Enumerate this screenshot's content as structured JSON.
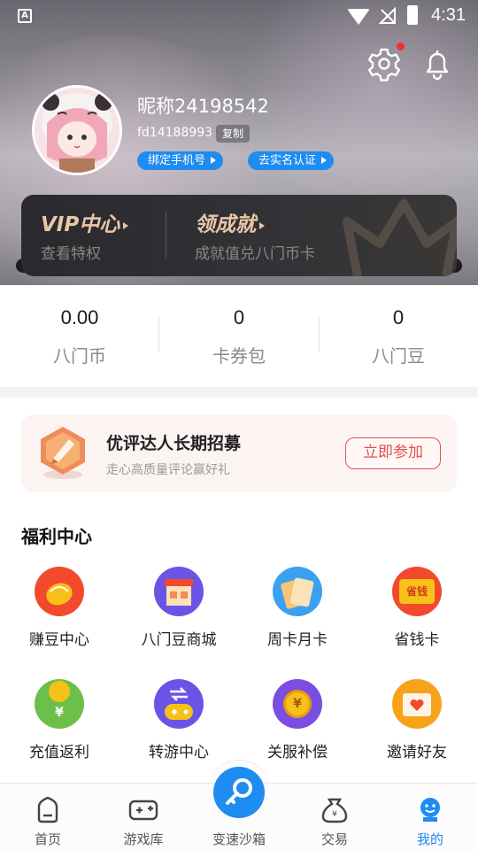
{
  "status_bar": {
    "time": "4:31",
    "notification_icon_letter": "A"
  },
  "profile": {
    "nickname": "昵称24198542",
    "user_id": "fd14188993",
    "copy_label": "复制",
    "bind_phone_label": "绑定手机号",
    "real_name_label": "去实名认证"
  },
  "vip_card": {
    "vip_title": "VIP中心",
    "vip_sub": "查看特权",
    "achievement_title": "领成就",
    "achievement_sub": "成就值兑八门币卡"
  },
  "stats": [
    {
      "value": "0.00",
      "label": "八门币"
    },
    {
      "value": "0",
      "label": "卡券包"
    },
    {
      "value": "0",
      "label": "八门豆"
    }
  ],
  "recruit_banner": {
    "title": "优评达人长期招募",
    "subtitle": "走心高质量评论赢好礼",
    "button_label": "立即参加"
  },
  "welfare": {
    "title": "福利中心",
    "items": [
      {
        "label": "赚豆中心",
        "icon": "bean-icon"
      },
      {
        "label": "八门豆商城",
        "icon": "shop-icon"
      },
      {
        "label": "周卡月卡",
        "icon": "card-icon"
      },
      {
        "label": "省钱卡",
        "icon": "save-money-card-icon",
        "icon_text": "省钱"
      },
      {
        "label": "充值返利",
        "icon": "recharge-rebate-icon",
        "icon_text": "¥"
      },
      {
        "label": "转游中心",
        "icon": "transfer-game-icon"
      },
      {
        "label": "关服补偿",
        "icon": "compensation-coin-icon",
        "icon_text": "¥"
      },
      {
        "label": "邀请好友",
        "icon": "invite-envelope-icon"
      }
    ]
  },
  "bottom_nav": {
    "items": [
      {
        "label": "首页",
        "icon": "home-icon"
      },
      {
        "label": "游戏库",
        "icon": "gamepad-icon"
      },
      {
        "label": "变速沙箱",
        "icon": "sandbox-key-icon"
      },
      {
        "label": "交易",
        "icon": "trade-bag-icon"
      },
      {
        "label": "我的",
        "icon": "mine-icon"
      }
    ],
    "active": "我的"
  },
  "colors": {
    "accent": "#1e8cf0",
    "vip_gold": "#e9c7a6",
    "recruit_red": "#e2514a"
  }
}
